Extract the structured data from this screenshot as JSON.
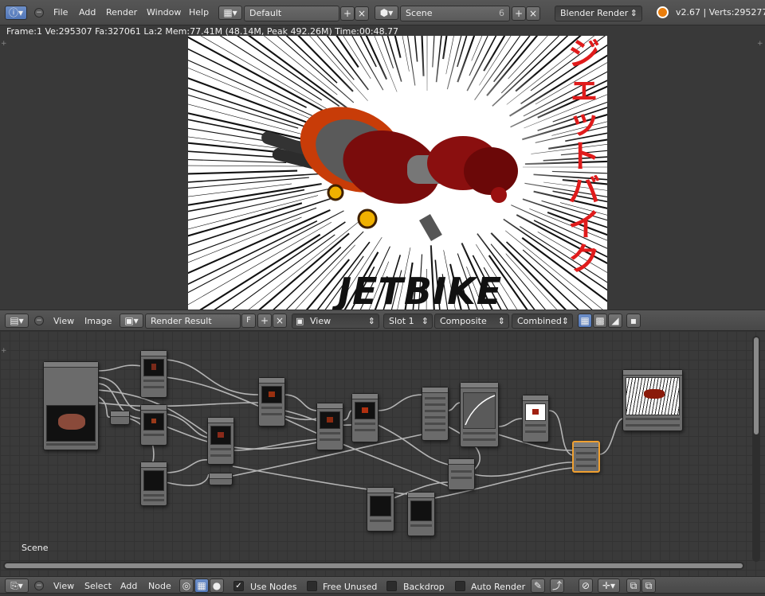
{
  "top_bar": {
    "menus": [
      "File",
      "Add",
      "Render",
      "Window",
      "Help"
    ],
    "screen_layout": "Default",
    "scene": "Scene",
    "scene_users": "6",
    "render_engine": "Blender Render",
    "version_info": "v2.67 | Verts:295277"
  },
  "render_stats": "Frame:1 Ve:295307 Fa:327061 La:2 Mem:77.41M (48.14M, Peak 492.26M) Time:00:48.77",
  "render_image": {
    "title": "JETBIKE",
    "katakana": [
      "ジ",
      "ェ",
      "ッ",
      "ト",
      "バ",
      "イ",
      "ク"
    ]
  },
  "image_header": {
    "menus": [
      "View",
      "Image"
    ],
    "image_name": "Render Result",
    "fake_user": "F",
    "view_mode": "View",
    "slot": "Slot 1",
    "layer": "Composite",
    "pass": "Combined"
  },
  "node_editor": {
    "scene_label": "Scene"
  },
  "bottom_bar": {
    "menus": [
      "View",
      "Select",
      "Add",
      "Node"
    ],
    "use_nodes_label": "Use Nodes",
    "use_nodes_checked": true,
    "free_unused_label": "Free Unused",
    "backdrop_label": "Backdrop",
    "auto_render_label": "Auto Render"
  },
  "colors": {
    "accent": "#5277b8",
    "katakana_red": "#e01b1b",
    "active_node_border": "#f0a030"
  }
}
